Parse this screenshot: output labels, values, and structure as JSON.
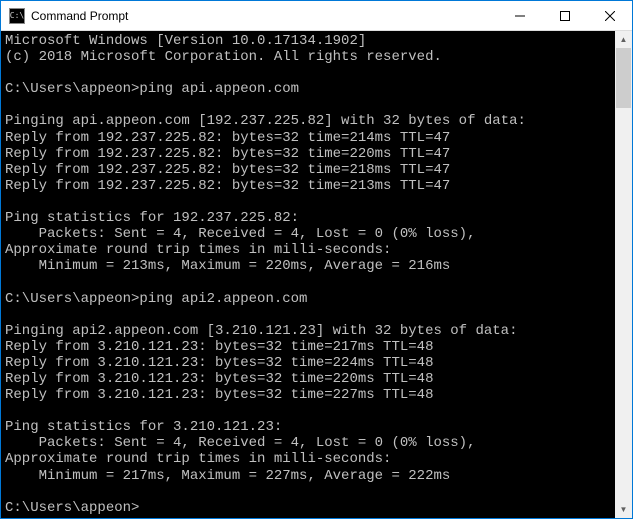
{
  "titlebar": {
    "title": "Command Prompt",
    "icon_label": "C:\\"
  },
  "console": {
    "lines": {
      "l0": "Microsoft Windows [Version 10.0.17134.1902]",
      "l1": "(c) 2018 Microsoft Corporation. All rights reserved.",
      "l2": "",
      "l3": "C:\\Users\\appeon>ping api.appeon.com",
      "l4": "",
      "l5": "Pinging api.appeon.com [192.237.225.82] with 32 bytes of data:",
      "l6": "Reply from 192.237.225.82: bytes=32 time=214ms TTL=47",
      "l7": "Reply from 192.237.225.82: bytes=32 time=220ms TTL=47",
      "l8": "Reply from 192.237.225.82: bytes=32 time=218ms TTL=47",
      "l9": "Reply from 192.237.225.82: bytes=32 time=213ms TTL=47",
      "l10": "",
      "l11": "Ping statistics for 192.237.225.82:",
      "l12": "    Packets: Sent = 4, Received = 4, Lost = 0 (0% loss),",
      "l13": "Approximate round trip times in milli-seconds:",
      "l14": "    Minimum = 213ms, Maximum = 220ms, Average = 216ms",
      "l15": "",
      "l16": "C:\\Users\\appeon>ping api2.appeon.com",
      "l17": "",
      "l18": "Pinging api2.appeon.com [3.210.121.23] with 32 bytes of data:",
      "l19": "Reply from 3.210.121.23: bytes=32 time=217ms TTL=48",
      "l20": "Reply from 3.210.121.23: bytes=32 time=224ms TTL=48",
      "l21": "Reply from 3.210.121.23: bytes=32 time=220ms TTL=48",
      "l22": "Reply from 3.210.121.23: bytes=32 time=227ms TTL=48",
      "l23": "",
      "l24": "Ping statistics for 3.210.121.23:",
      "l25": "    Packets: Sent = 4, Received = 4, Lost = 0 (0% loss),",
      "l26": "Approximate round trip times in milli-seconds:",
      "l27": "    Minimum = 217ms, Maximum = 227ms, Average = 222ms",
      "l28": "",
      "l29": "C:\\Users\\appeon>"
    }
  }
}
